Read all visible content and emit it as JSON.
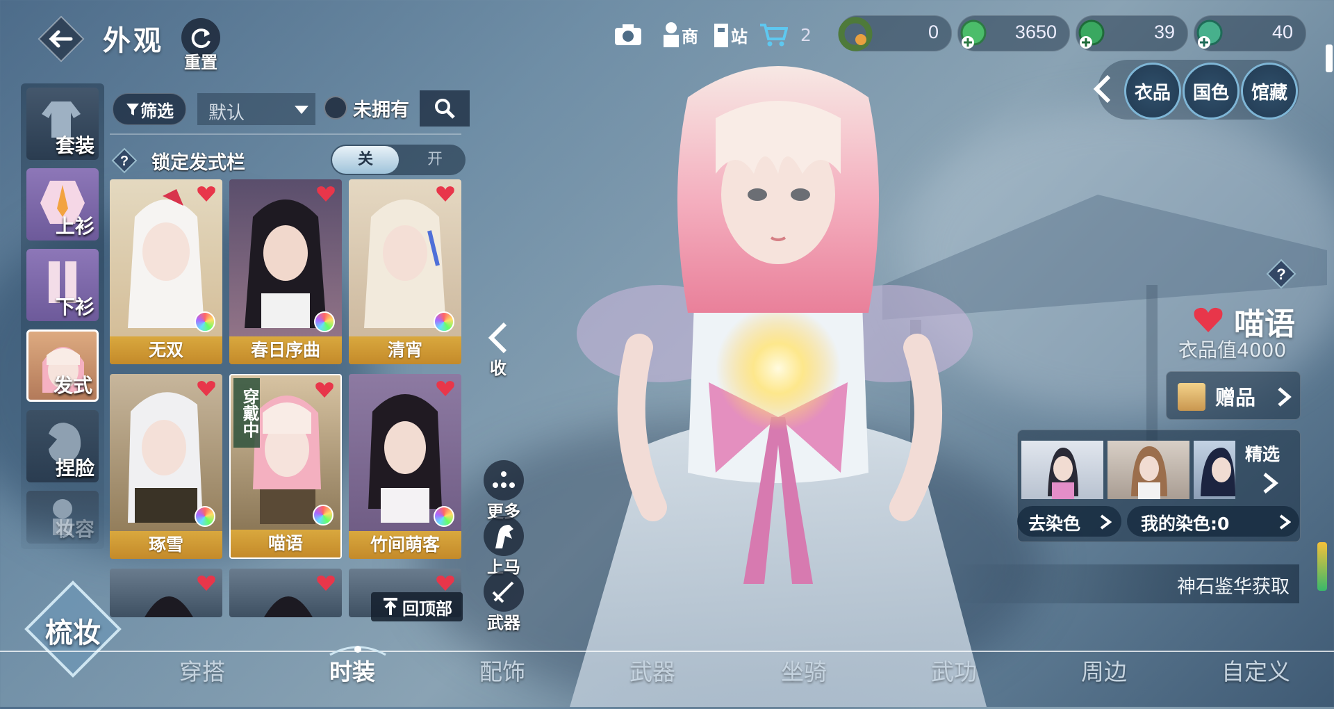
{
  "header": {
    "title": "外观",
    "reset_label": "重置",
    "shop_label": "商",
    "station_label": "站",
    "cart_count": "2"
  },
  "currencies": [
    {
      "icon": "jade-bracelet-icon",
      "amount": "0"
    },
    {
      "icon": "green-jade-plus-icon",
      "amount": "3650"
    },
    {
      "icon": "green-coin-plus-icon",
      "amount": "39"
    },
    {
      "icon": "teal-coin-plus-icon",
      "amount": "40"
    }
  ],
  "right_tabs": {
    "tab1": "衣品",
    "tab2": "国色",
    "tab3": "馆藏"
  },
  "categories": [
    {
      "label": "套装"
    },
    {
      "label": "上衫"
    },
    {
      "label": "下衫"
    },
    {
      "label": "发式"
    },
    {
      "label": "捏脸"
    },
    {
      "label": "妆容"
    }
  ],
  "filter": {
    "filter_label": "筛选",
    "sort_value": "默认",
    "not_owned_label": "未拥有"
  },
  "lock": {
    "label": "锁定发式栏",
    "off": "关",
    "on": "开"
  },
  "items": [
    {
      "name": "无双"
    },
    {
      "name": "春日序曲"
    },
    {
      "name": "清宵"
    },
    {
      "name": "琢雪"
    },
    {
      "name": "喵语",
      "wearing": "穿戴中"
    },
    {
      "name": "竹间萌客"
    }
  ],
  "back_to_top": "回顶部",
  "side_actions": {
    "collapse": "收",
    "more": "更多",
    "mount": "上马",
    "weapon": "武器"
  },
  "makeup_button": "梳妆",
  "detail": {
    "name": "喵语",
    "value_label": "衣品值4000",
    "gift_label": "赠品",
    "featured_label": "精选",
    "remove_dye": "去染色",
    "my_dye": "我的染色:0",
    "source": "神石鉴华获取"
  },
  "nav": [
    "穿搭",
    "时装",
    "配饰",
    "武器",
    "坐骑",
    "武功",
    "周边",
    "自定义"
  ],
  "colors": {
    "accent_gold": "#d6a23a",
    "heart_red": "#e8364a",
    "tab_ring": "#7fb6d6"
  }
}
